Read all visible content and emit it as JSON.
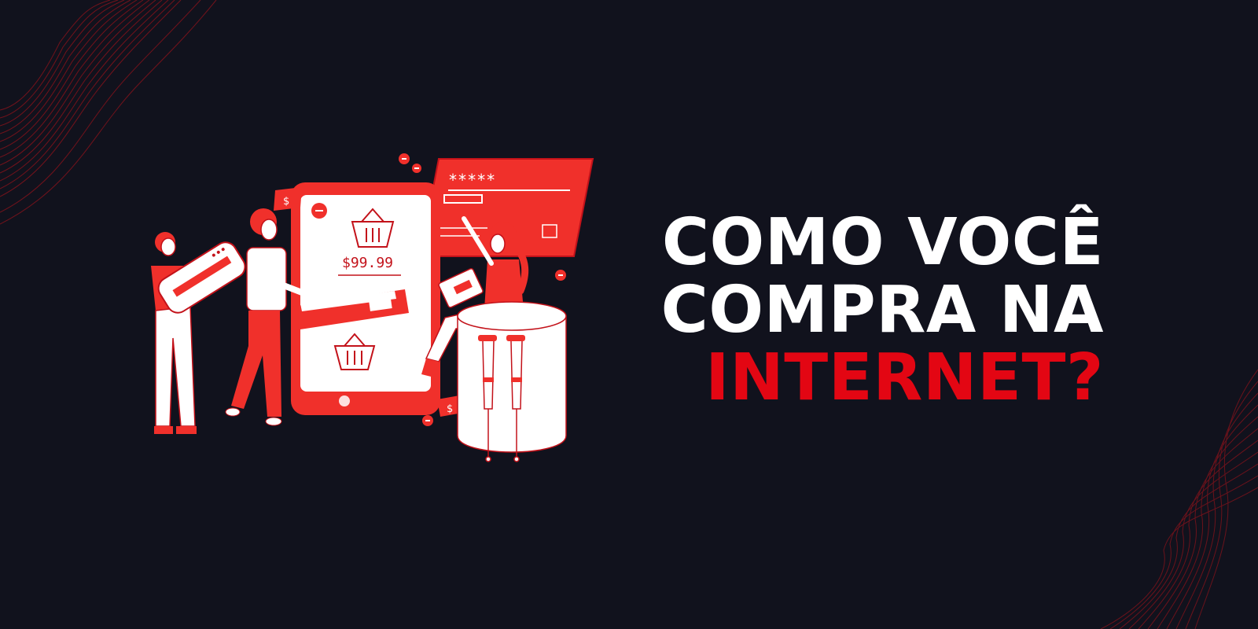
{
  "headline": {
    "line1": "COMO VOCÊ",
    "line2": "COMPRA NA",
    "line3": "INTERNET?"
  },
  "illustration": {
    "phone_price": "$99.99",
    "password_mask": "*****",
    "dollar_sign": "$"
  },
  "colors": {
    "background": "#11121d",
    "accent_red": "#e30613",
    "illustration_red": "#f0302b",
    "white": "#ffffff"
  }
}
